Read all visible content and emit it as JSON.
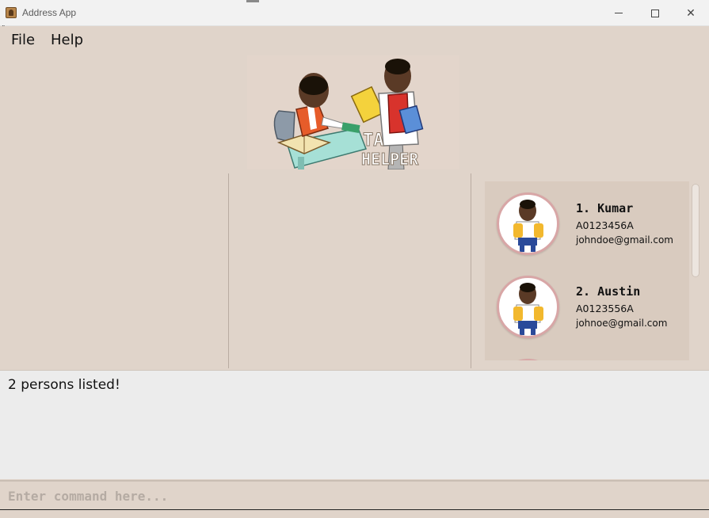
{
  "window": {
    "title": "Address App",
    "minimize_icon": "minimize-icon",
    "maximize_icon": "maximize-icon",
    "close_icon": "close-icon",
    "close_glyph": "✕"
  },
  "menu": {
    "file_label": "File",
    "help_label": "Help"
  },
  "logo": {
    "text_line1": "TA",
    "text_line2": "HELPER"
  },
  "persons": [
    {
      "index_name": "1.  Kumar",
      "student_id": "A0123456A",
      "email": "johndoe@gmail.com"
    },
    {
      "index_name": "2.  Austin",
      "student_id": "A0123556A",
      "email": "johnoe@gmail.com"
    }
  ],
  "result": {
    "message": "2 persons listed!"
  },
  "command": {
    "placeholder": "Enter command here..."
  },
  "colors": {
    "background": "#e0d4ca",
    "list_background": "#d9cbbf",
    "result_background": "#ececec",
    "avatar_border": "#d8a6a6"
  }
}
